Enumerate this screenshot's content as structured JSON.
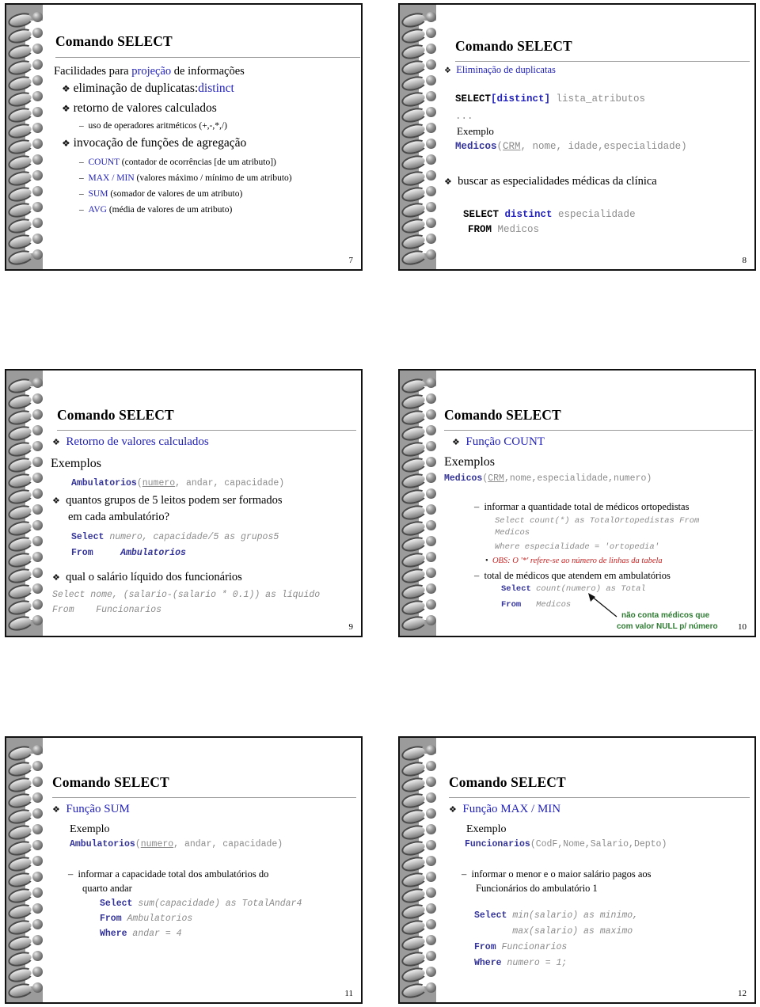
{
  "document": {
    "kind": "lecture-slide-handout",
    "slide_count": 6,
    "common_title": "Comando SELECT"
  },
  "slides": [
    {
      "number": "7",
      "title": "Comando SELECT",
      "lines": [
        {
          "text": "Facilidades para "
        },
        {
          "text": "projeção",
          "color": "blue"
        },
        {
          "text": " de informações"
        },
        {
          "text": "eliminação de duplicatas:"
        },
        {
          "text": "distinct",
          "color": "blue"
        },
        {
          "text": "retorno de valores calculados"
        },
        {
          "text": "uso de operadores aritméticos (+,-,*,/)"
        },
        {
          "text": "invocação de funções de agregação"
        },
        {
          "text": "COUNT",
          "color": "blue"
        },
        {
          "text": " (contador de ocorrências [de um atributo])"
        },
        {
          "text": "MAX / MIN",
          "color": "blue"
        },
        {
          "text": " (valores máximo / mínimo de um atributo)"
        },
        {
          "text": "SUM",
          "color": "blue"
        },
        {
          "text": " (somador de valores de um atributo)"
        },
        {
          "text": "AVG",
          "color": "blue"
        },
        {
          "text": " (média de valores de um atributo)"
        }
      ],
      "s7": {
        "l1a": "Facilidades para ",
        "l1b": "projeção",
        "l1c": " de informações",
        "l2a": "eliminação de duplicatas:",
        "l2b": "distinct",
        "l3": "retorno de valores calculados",
        "l4": "uso de operadores aritméticos (+,-,*,/)",
        "l5": "invocação de funções de agregação",
        "l6a": "COUNT",
        "l6b": " (contador de ocorrências [de um atributo])",
        "l7a": "MAX / MIN",
        "l7b": " (valores máximo / mínimo de um atributo)",
        "l8a": "SUM",
        "l8b": " (somador de valores de um atributo)",
        "l9a": "AVG",
        "l9b": " (média de valores de um atributo)"
      }
    },
    {
      "number": "8",
      "title": "Comando SELECT",
      "s8": {
        "b1": "Eliminação de duplicatas",
        "code1a": "SELECT",
        "code1b": "[distinct]",
        "code1c": " lista_atributos",
        "code2": "...",
        "exemplo": "Exemplo",
        "code3a": "Medicos",
        "code3b": "(",
        "code3c": "CRM",
        "code3d": ", nome, idade,especialidade)",
        "b2": "buscar as especialidades médicas da clínica",
        "code4a": "SELECT",
        "code4b": "distinct",
        "code4c": " especialidade",
        "code5a": "FROM",
        "code5b": " Medicos"
      }
    },
    {
      "number": "9",
      "title": "Comando SELECT",
      "s9": {
        "b1": "Retorno de valores calculados",
        "exemplos": "Exemplos",
        "rel_a": "Ambulatorios",
        "rel_b": "(",
        "rel_c": "numero",
        "rel_d": ", andar, capacidade)",
        "b2l1": "quantos grupos de 5 leitos podem ser formados",
        "b2l2": "em cada ambulatório?",
        "c1a": "Select",
        "c1b": " numero, capacidade/5 as grupos5",
        "c2a": "From",
        "c2b": "     Ambulatorios",
        "b3": "qual o salário líquido dos funcionários",
        "c3": "Select nome, (salario-(salario * 0.1)) as líquido",
        "c4": "From    Funcionarios"
      }
    },
    {
      "number": "10",
      "title": "Comando SELECT",
      "s10": {
        "b1": "Função COUNT",
        "exemplos": "Exemplos",
        "rel_a": "Medicos",
        "rel_b": "(",
        "rel_c": "CRM",
        "rel_d": ",nome,especialidade,numero)",
        "d1": "informar  a quantidade total de médicos ortopedistas",
        "c1a": "Select",
        "c1b": " count(*) as TotalOrtopedistas From",
        "c1c": "Medicos",
        "c2": "Where especialidade = 'ortopedia'",
        "obs": "OBS: O  '*'  refere-se ao número de linhas da tabela",
        "d2": "total de médicos que atendem em ambulatórios",
        "c3a": "Select",
        "c3b": " count(numero) as Total",
        "c4a": "From",
        "c4b": "   Medicos",
        "note1": "não conta médicos que",
        "note2": "com valor NULL p/ número"
      }
    },
    {
      "number": "11",
      "title": "Comando SELECT",
      "s11": {
        "b1": "Função SUM",
        "exemplo": "Exemplo",
        "rel_a": "Ambulatorios",
        "rel_b": "(",
        "rel_c": "numero",
        "rel_d": ", andar, capacidade)",
        "d1l1": "informar a capacidade total dos ambulatórios do",
        "d1l2": "quarto andar",
        "c1a": "Select",
        "c1b": " sum(capacidade) as TotalAndar4",
        "c2a": "From",
        "c2b": " Ambulatorios",
        "c3a": "Where",
        "c3b": " andar = 4"
      }
    },
    {
      "number": "12",
      "title": "Comando SELECT",
      "s12": {
        "b1": "Função MAX / MIN",
        "exemplo": "Exemplo",
        "rel_a": "Funcionarios",
        "rel_b": "(CodF,Nome,Salario,Depto)",
        "d1l1": "informar o menor e o maior salário pagos aos",
        "d1l2": "Funcionários do ambulatório 1",
        "c1a": "Select",
        "c1b": " min(salario) as minimo,",
        "c2": "       max(salario) as maximo",
        "c3a": "From",
        "c3b": " Funcionarios",
        "c4a": "Where",
        "c4b": " numero = 1;"
      }
    }
  ],
  "colors": {
    "accent_blue": "#2222bb",
    "code_navy": "#33339b",
    "code_grey": "#8b8b8b",
    "note_red": "#cc2222",
    "note_green": "#2e7d32",
    "binder_grey": "#9b9b9b"
  },
  "icons": {
    "bullet_diamond": "❖",
    "bullet_dash": "–",
    "bullet_dot": "•"
  }
}
